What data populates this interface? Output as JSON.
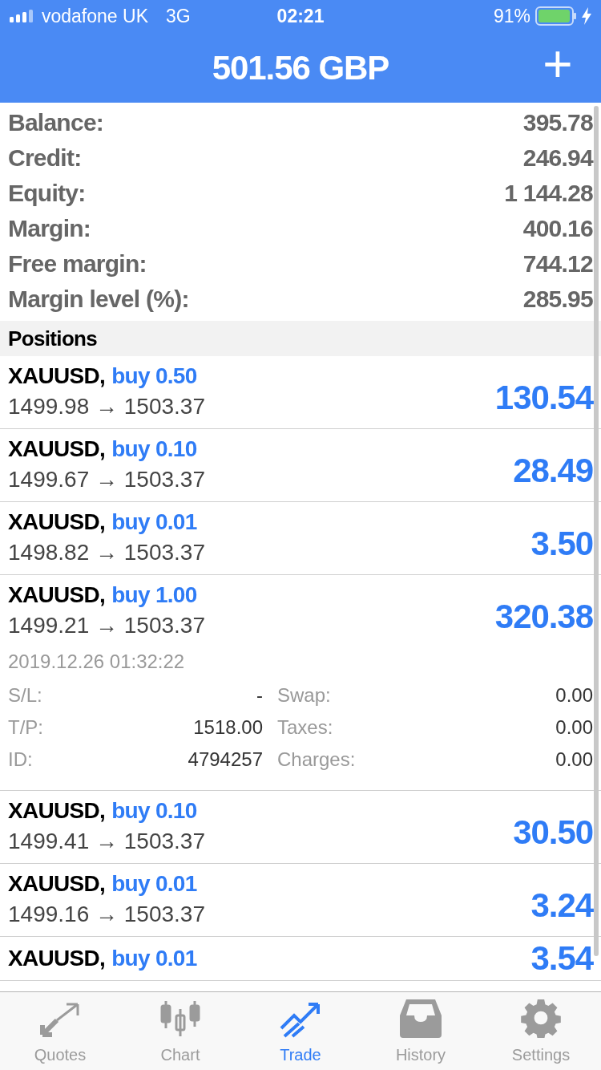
{
  "status_bar": {
    "carrier": "vodafone UK",
    "network": "3G",
    "time": "02:21",
    "battery": "91%"
  },
  "header": {
    "title": "501.56 GBP",
    "add": "+"
  },
  "summary": [
    {
      "label": "Balance:",
      "value": "395.78"
    },
    {
      "label": "Credit:",
      "value": "246.94"
    },
    {
      "label": "Equity:",
      "value": "1 144.28"
    },
    {
      "label": "Margin:",
      "value": "400.16"
    },
    {
      "label": "Free margin:",
      "value": "744.12"
    },
    {
      "label": "Margin level (%):",
      "value": "285.95"
    }
  ],
  "positions_title": "Positions",
  "positions": [
    {
      "symbol": "XAUUSD,",
      "order": "buy 0.50",
      "prices": "1499.98 → 1503.37",
      "profit": "130.54"
    },
    {
      "symbol": "XAUUSD,",
      "order": "buy 0.10",
      "prices": "1499.67 → 1503.37",
      "profit": "28.49"
    },
    {
      "symbol": "XAUUSD,",
      "order": "buy 0.01",
      "prices": "1498.82 → 1503.37",
      "profit": "3.50"
    },
    {
      "symbol": "XAUUSD,",
      "order": "buy 1.00",
      "prices": "1499.21 → 1503.37",
      "profit": "320.38",
      "details": {
        "time": "2019.12.26 01:32:22",
        "rows": [
          {
            "label": "S/L:",
            "value": "-",
            "label_2": "Swap:",
            "value_2": "0.00"
          },
          {
            "label": "T/P:",
            "value": "1518.00",
            "label_2": "Taxes:",
            "value_2": "0.00"
          },
          {
            "label": "ID:",
            "value": "4794257",
            "label_2": "Charges:",
            "value_2": "0.00"
          }
        ]
      }
    },
    {
      "symbol": "XAUUSD,",
      "order": "buy 0.10",
      "prices": "1499.41 → 1503.37",
      "profit": "30.50"
    },
    {
      "symbol": "XAUUSD,",
      "order": "buy 0.01",
      "prices": "1499.16 → 1503.37",
      "profit": "3.24"
    },
    {
      "symbol": "XAUUSD,",
      "order": "buy 0.01",
      "profit": "3.54"
    }
  ],
  "tabs": [
    {
      "label": "Quotes",
      "kind": "quotes",
      "selected": false
    },
    {
      "label": "Chart",
      "kind": "chart",
      "selected": false
    },
    {
      "label": "Trade",
      "kind": "trade",
      "selected": true
    },
    {
      "label": "History",
      "kind": "history",
      "selected": false
    },
    {
      "label": "Settings",
      "kind": "settings",
      "selected": false
    }
  ]
}
